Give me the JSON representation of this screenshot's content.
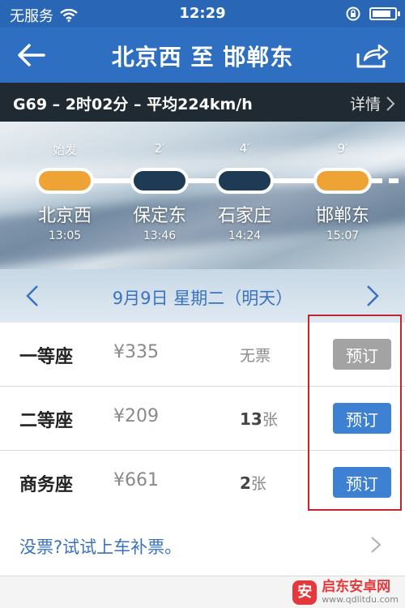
{
  "status": {
    "carrier": "无服务",
    "time": "12:29",
    "battery_level": 0.85
  },
  "nav": {
    "title": "北京西 至 邯郸东"
  },
  "train": {
    "summary": "G69 – 2时02分 – 平均224km/h",
    "detail_label": "详情"
  },
  "route": {
    "stops": [
      {
        "name": "北京西",
        "time": "13:05",
        "mins": "始发",
        "type": "end"
      },
      {
        "name": "保定东",
        "time": "13:46",
        "mins": "2′",
        "type": "mid"
      },
      {
        "name": "石家庄",
        "time": "14:24",
        "mins": "4′",
        "type": "mid"
      },
      {
        "name": "邯郸东",
        "time": "15:07",
        "mins": "9′",
        "type": "end"
      }
    ]
  },
  "date": {
    "label": "9月9日 星期二（明天）"
  },
  "seats": [
    {
      "class": "一等座",
      "price": "¥335",
      "avail_num": "",
      "avail_text": "无票",
      "button": "预订",
      "enabled": false
    },
    {
      "class": "二等座",
      "price": "¥209",
      "avail_num": "13",
      "avail_text": "张",
      "button": "预订",
      "enabled": true
    },
    {
      "class": "商务座",
      "price": "¥661",
      "avail_num": "2",
      "avail_text": "张",
      "button": "预订",
      "enabled": true
    }
  ],
  "tip": {
    "text": "没票?试试上车补票。"
  },
  "watermark": {
    "logo": "安",
    "title": "启东安卓网",
    "url": "www.qdlitdu.com"
  },
  "colors": {
    "nav": "#2f6fc2",
    "accent": "#3e80d2",
    "stop_end": "#efa334",
    "highlight": "#c0272d"
  }
}
